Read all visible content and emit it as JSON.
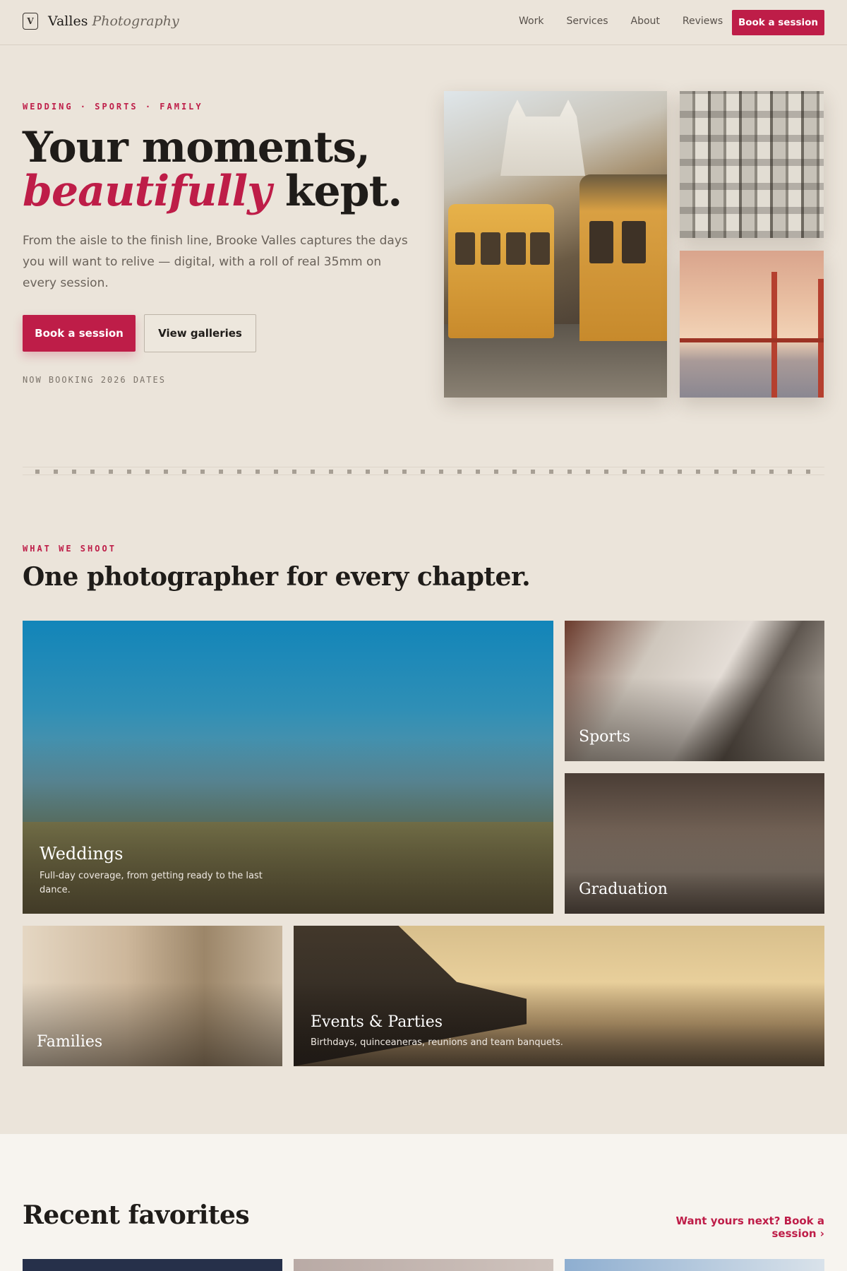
{
  "nav": {
    "brand_mark": "V",
    "brand_name": "Valles",
    "brand_sub": "Photography",
    "links": [
      "Work",
      "Services",
      "About",
      "Reviews"
    ],
    "cta": "Book a session"
  },
  "hero": {
    "eyebrow": "WEDDING · SPORTS · FAMILY",
    "title_line1": "Your moments,",
    "title_accent": "beautifully",
    "title_end": " kept.",
    "body": "From the aisle to the finish line, Brooke Valles captures the days you will want to relive — digital, with a roll of real 35mm on every session.",
    "primary_button": "Book a session",
    "secondary_button": "View galleries",
    "booking_note": "NOW BOOKING 2026 DATES"
  },
  "services": {
    "eyebrow": "WHAT WE SHOOT",
    "title": "One photographer for every chapter.",
    "cards": [
      {
        "title": "Weddings",
        "desc": "Full-day coverage, from getting ready to the last dance."
      },
      {
        "title": "Sports",
        "desc": ""
      },
      {
        "title": "Graduation",
        "desc": ""
      },
      {
        "title": "Families",
        "desc": ""
      },
      {
        "title": "Events & Parties",
        "desc": "Birthdays, quinceaneras, reunions and team banquets."
      }
    ]
  },
  "recent": {
    "title": "Recent favorites",
    "link": "Want yours next? Book a session ›"
  },
  "colors": {
    "accent": "#be1d48",
    "background": "#ebe4da",
    "text": "#1f1c19"
  }
}
